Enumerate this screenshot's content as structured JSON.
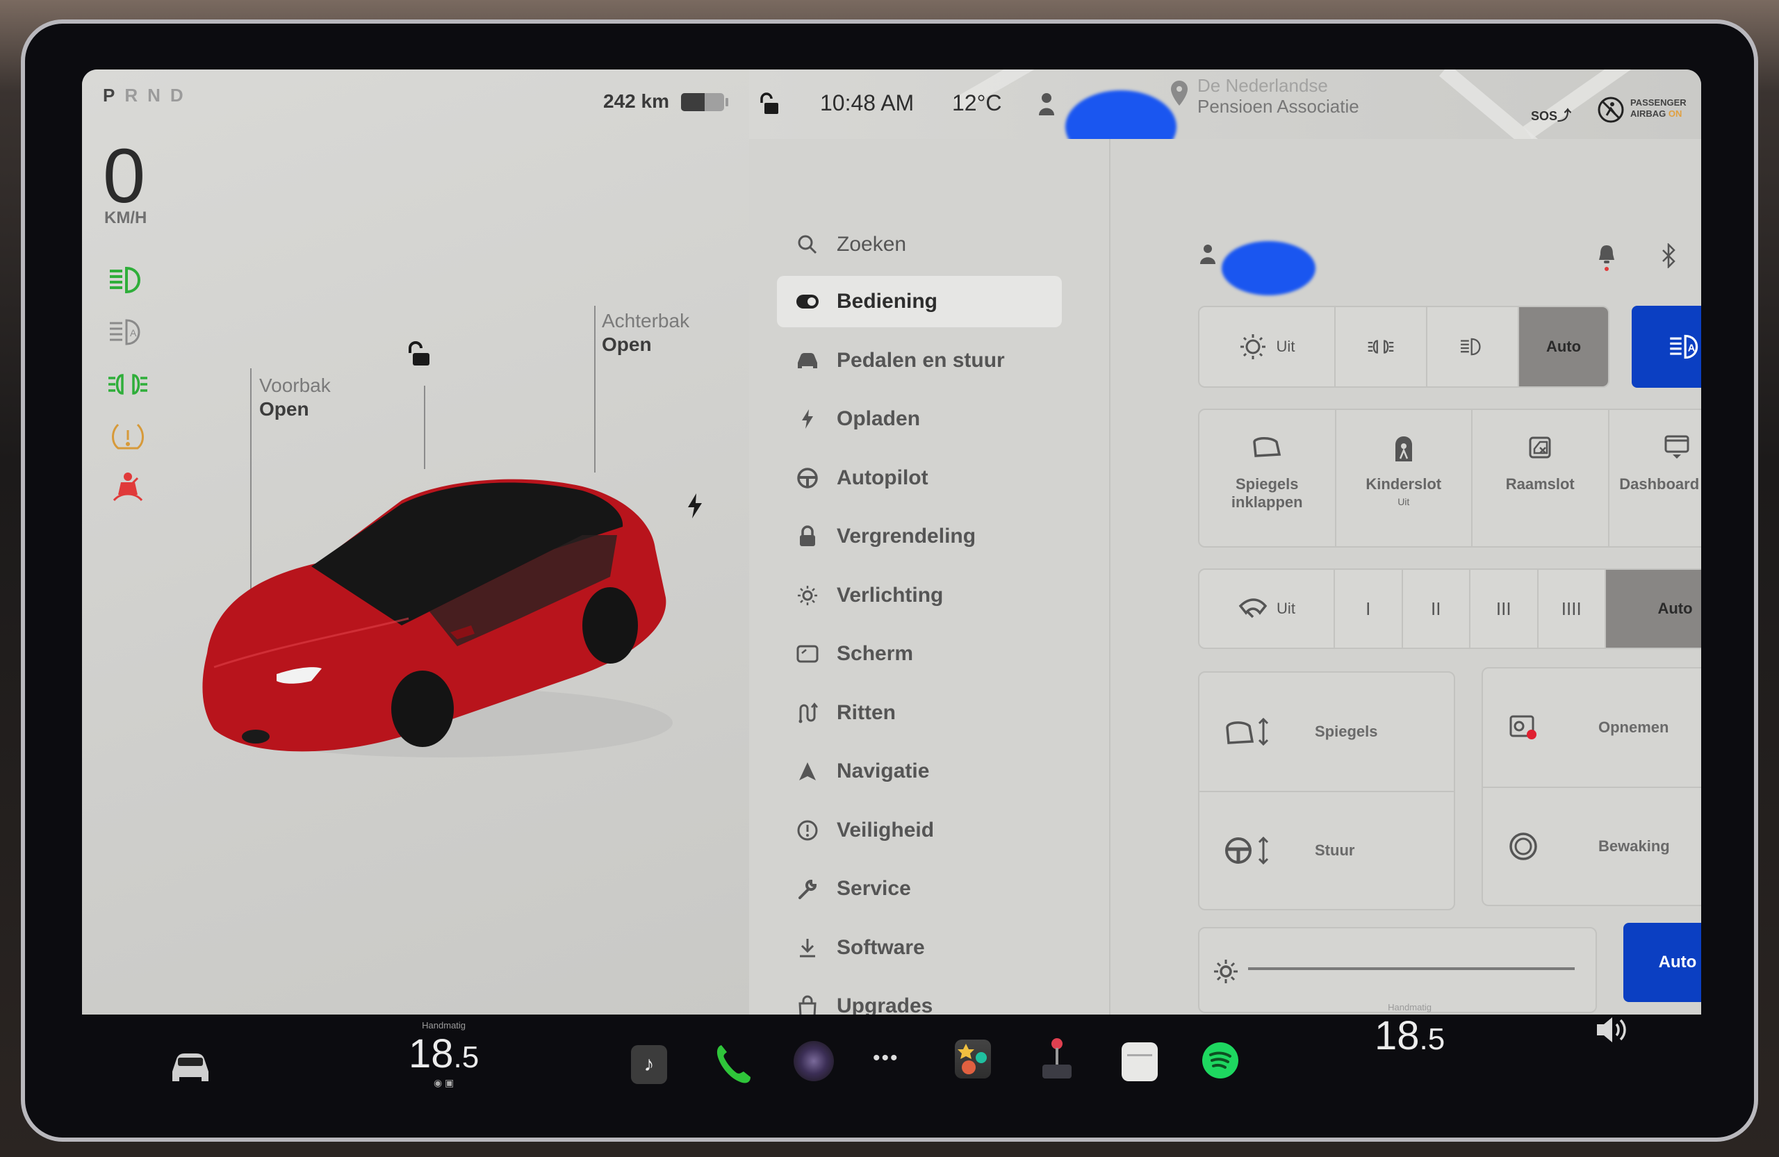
{
  "drive": {
    "gears": [
      "P",
      "R",
      "N",
      "D"
    ],
    "active_gear": "P",
    "speed": "0",
    "speed_unit": "KM/H",
    "range": "242 km",
    "battery_percent": 55
  },
  "telltales": [
    {
      "name": "low-beam-icon",
      "color": "#2fae3a"
    },
    {
      "name": "auto-high-beam-icon",
      "color": "#8a8a8a"
    },
    {
      "name": "parking-lights-icon",
      "color": "#2fae3a"
    },
    {
      "name": "tire-pressure-warning-icon",
      "color": "#d79a3a"
    },
    {
      "name": "seatbelt-warning-icon",
      "color": "#e03a3a"
    }
  ],
  "car_status": {
    "frunk": {
      "label": "Voorbak",
      "value": "Open"
    },
    "trunk": {
      "label": "Achterbak",
      "value": "Open"
    }
  },
  "topbar": {
    "time": "10:48 AM",
    "temperature": "12°C",
    "location_line1": "De Nederlandse",
    "location_line2": "Pensioen Associatie",
    "sos": "SOS",
    "airbag_line1": "PASSENGER",
    "airbag_line2": "AIRBAG",
    "airbag_state": "ON"
  },
  "menu": {
    "search_label": "Zoeken",
    "items": [
      {
        "label": "Bediening",
        "icon": "toggle-icon",
        "active": true
      },
      {
        "label": "Pedalen en stuur",
        "icon": "car-icon"
      },
      {
        "label": "Opladen",
        "icon": "bolt-icon"
      },
      {
        "label": "Autopilot",
        "icon": "steering-wheel-icon"
      },
      {
        "label": "Vergrendeling",
        "icon": "lock-icon"
      },
      {
        "label": "Verlichting",
        "icon": "light-bulb-icon"
      },
      {
        "label": "Scherm",
        "icon": "display-icon"
      },
      {
        "label": "Ritten",
        "icon": "trips-icon"
      },
      {
        "label": "Navigatie",
        "icon": "navigation-arrow-icon"
      },
      {
        "label": "Veiligheid",
        "icon": "safety-icon"
      },
      {
        "label": "Service",
        "icon": "wrench-icon"
      },
      {
        "label": "Software",
        "icon": "download-icon"
      },
      {
        "label": "Upgrades",
        "icon": "shopping-bag-icon"
      }
    ]
  },
  "controls": {
    "lights": {
      "options": [
        "Uit",
        "",
        "",
        "Auto"
      ],
      "selected": "Auto",
      "auto_high_beam_active": true
    },
    "tiles": [
      {
        "label": "Spiegels inklappen",
        "sub": ""
      },
      {
        "label": "Kinderslot",
        "sub": "Uit"
      },
      {
        "label": "Raamslot",
        "sub": ""
      },
      {
        "label": "Dashboard kast",
        "sub": ""
      }
    ],
    "wipers": {
      "options": [
        "Uit",
        "I",
        "II",
        "III",
        "IIII",
        "Auto"
      ],
      "selected": "Auto"
    },
    "adjust": [
      {
        "label": "Spiegels"
      },
      {
        "label": "Stuur"
      }
    ],
    "dashcam": [
      {
        "label": "Opnemen"
      },
      {
        "label": "Bewaking"
      }
    ],
    "brightness": {
      "auto_label": "Auto",
      "level_percent": 100
    }
  },
  "dock": {
    "driver_temp_mode": "Handmatig",
    "driver_temp": "18",
    "driver_temp_dec": ".5",
    "passenger_temp_mode": "Handmatig",
    "passenger_temp": "18",
    "passenger_temp_dec": ".5",
    "apps": [
      "music-icon",
      "phone-icon",
      "camera-icon",
      "more-icon",
      "toybox-icon",
      "arcade-icon",
      "calendar-icon",
      "spotify-icon"
    ],
    "colors": {
      "phone": "#2fc53a",
      "spotify": "#1ed760"
    }
  }
}
